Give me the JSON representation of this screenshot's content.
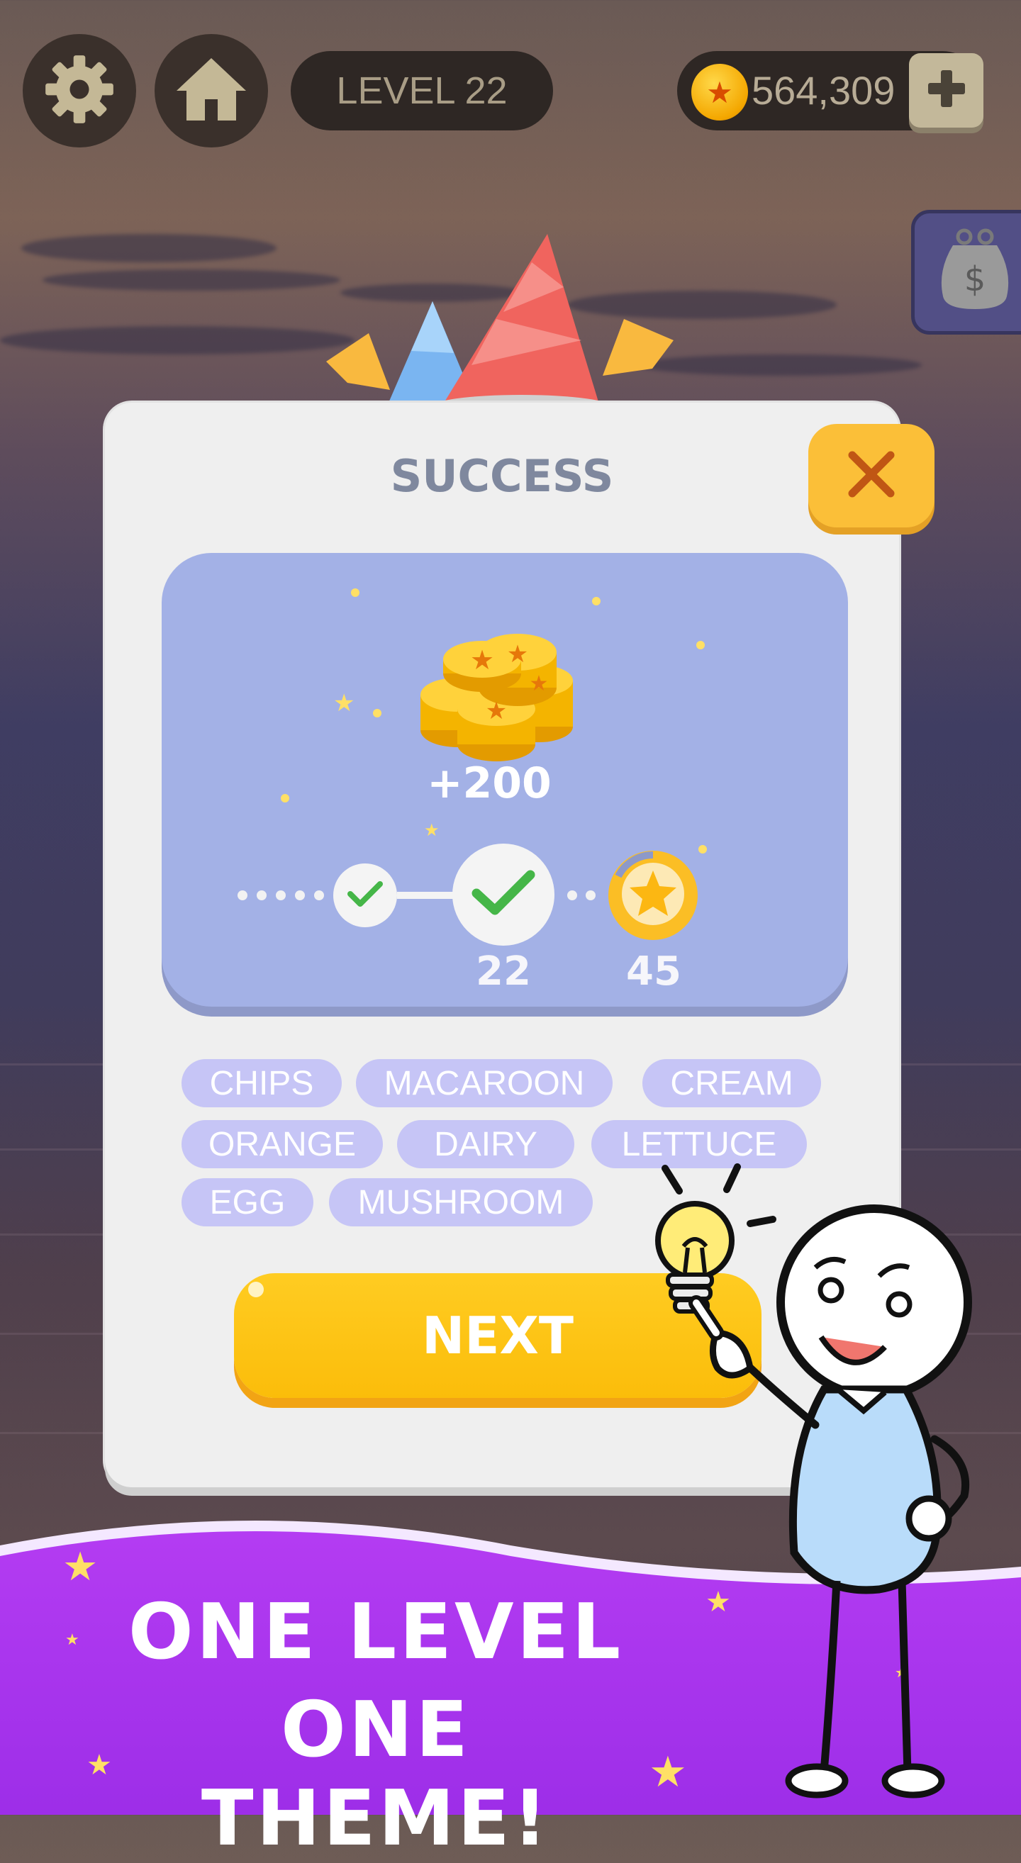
{
  "top_bar": {
    "settings_icon": "gear-icon",
    "home_icon": "home-icon",
    "level_label": "LEVEL 22",
    "coin_balance": "564,309",
    "add_coins_icon": "plus-icon",
    "wallet_icon": "money-bag-icon"
  },
  "result_dialog": {
    "title": "SUCCESS",
    "close_icon": "close-icon",
    "reward": {
      "amount": "+200",
      "icon": "coin-stack-icon"
    },
    "progress": {
      "current_level": "22",
      "milestone_level": "45",
      "milestone_icon": "star-icon"
    },
    "words": [
      "CHIPS",
      "MACAROON",
      "CREAM",
      "ORANGE",
      "DAIRY",
      "LETTUCE",
      "EGG",
      "MUSHROOM"
    ],
    "next_label": "NEXT"
  },
  "banner": {
    "line1": "ONE LEVEL",
    "line2": "ONE THEME!"
  },
  "colors": {
    "accent_yellow": "#fbbd0a",
    "card_blue": "#a3b1e6",
    "chip_lavender": "#c6c5f6",
    "banner_purple": "#a93cf0",
    "title_gray": "#7f889e"
  }
}
